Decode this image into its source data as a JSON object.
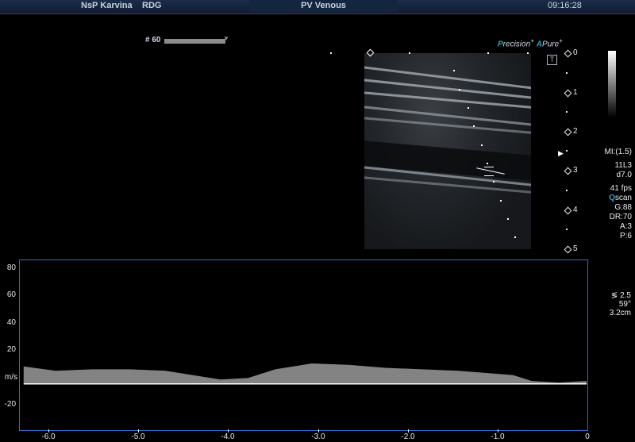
{
  "header": {
    "hospital": "NsP Karvina",
    "department": "RDG",
    "exam": "PV Venous",
    "time": "09:16:28"
  },
  "frame": {
    "number": "# 60"
  },
  "brand": {
    "precision_initial": "P",
    "precision_rest": "recision",
    "precision_sup": "+",
    "pure_initial": "A",
    "pure_rest": "Pure",
    "pure_sup": "+"
  },
  "depth_scale": [
    "0",
    "1",
    "2",
    "3",
    "4",
    "5"
  ],
  "imaging_params": {
    "mi": "MI:(1.5)",
    "probe": "11L3",
    "depth": "d7.0",
    "fps": "41 fps",
    "qscan_initial": "Q",
    "qscan_rest": "scan",
    "gain": "G:88",
    "dynamic_range": "DR:70",
    "averaging": "A:3",
    "persistence": "P:6"
  },
  "doppler_params": {
    "sample_volume": "2.5",
    "angle": "59°",
    "depth": "3.2cm"
  },
  "doppler": {
    "y_ticks": [
      "80",
      "60",
      "40",
      "20",
      "m/s",
      "-20"
    ],
    "x_ticks": [
      "-6.0",
      "-5.0",
      "-4.0",
      "-3.0",
      "-2.0",
      "-1.0",
      "0"
    ],
    "x_range": [
      -6.2,
      0
    ],
    "y_range": [
      -31,
      85
    ],
    "envelope_x": [
      -6.15,
      -5.8,
      -5.4,
      -5.0,
      -4.6,
      -4.3,
      -4.0,
      -3.7,
      -3.4,
      -3.0,
      -2.6,
      -2.2,
      -1.8,
      -1.4,
      -1.0,
      -0.8,
      -0.6,
      -0.3,
      0
    ],
    "envelope_y": [
      12,
      9,
      10,
      10,
      9,
      6,
      3,
      4,
      10,
      14,
      13,
      11,
      10,
      9,
      7,
      6,
      2,
      1,
      2
    ]
  }
}
